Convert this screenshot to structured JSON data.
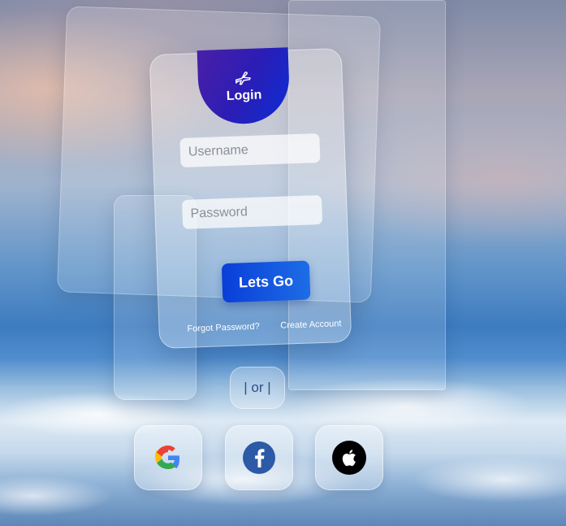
{
  "login": {
    "title": "Login",
    "username_placeholder": "Username",
    "password_placeholder": "Password",
    "submit_label": "Lets Go",
    "forgot_label": "Forgot Password?",
    "create_label": "Create Account"
  },
  "divider": {
    "label": "| or |"
  },
  "social": [
    {
      "name": "google",
      "icon": "google-icon"
    },
    {
      "name": "facebook",
      "icon": "facebook-icon"
    },
    {
      "name": "apple",
      "icon": "apple-icon"
    }
  ],
  "colors": {
    "badge_start": "#4a1fa6",
    "badge_end": "#0a2dd6",
    "button_start": "#0a3ed8",
    "button_end": "#1d6de6",
    "facebook_blue": "#2d5aa6"
  }
}
